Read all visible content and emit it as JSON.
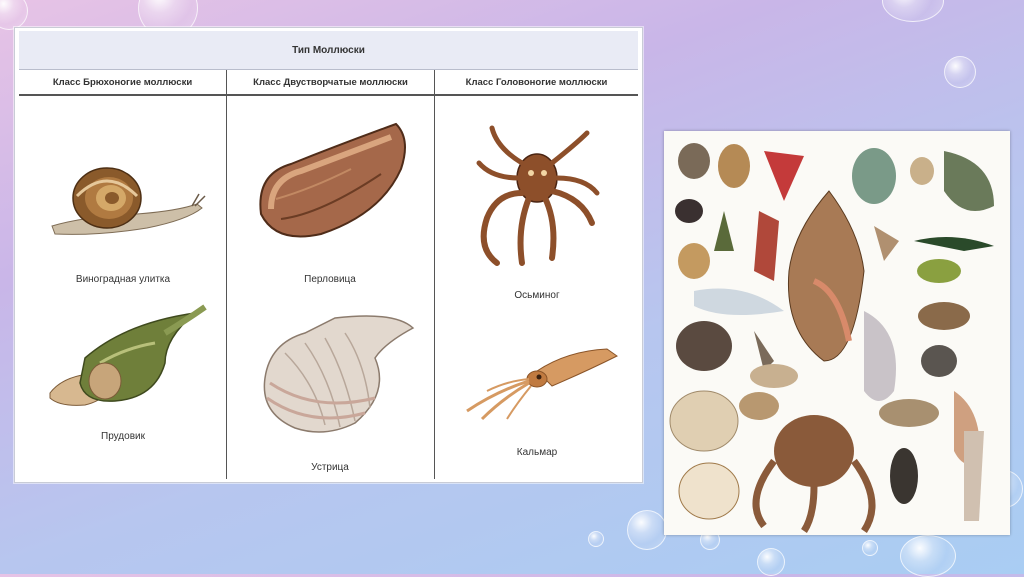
{
  "table": {
    "type_title": "Тип Моллюски",
    "classes": [
      {
        "label": "Класс Брюхоногие моллюски",
        "animals": [
          "Виноградная улитка",
          "Прудовик"
        ]
      },
      {
        "label": "Класс Двустворчатые моллюски",
        "animals": [
          "Перловица",
          "Устрица"
        ]
      },
      {
        "label": "Класс Головоногие моллюски",
        "animals": [
          "Осьминог",
          "Кальмар"
        ]
      }
    ]
  },
  "colors": {
    "header_bg": "#e9ebf5",
    "snail_shell": "#8a5a2b",
    "pondsnail": "#6f7f3a",
    "mussel": "#a5684a",
    "oyster": "#d9cfc6",
    "octopus": "#8d4f2a",
    "squid": "#d69a62"
  }
}
